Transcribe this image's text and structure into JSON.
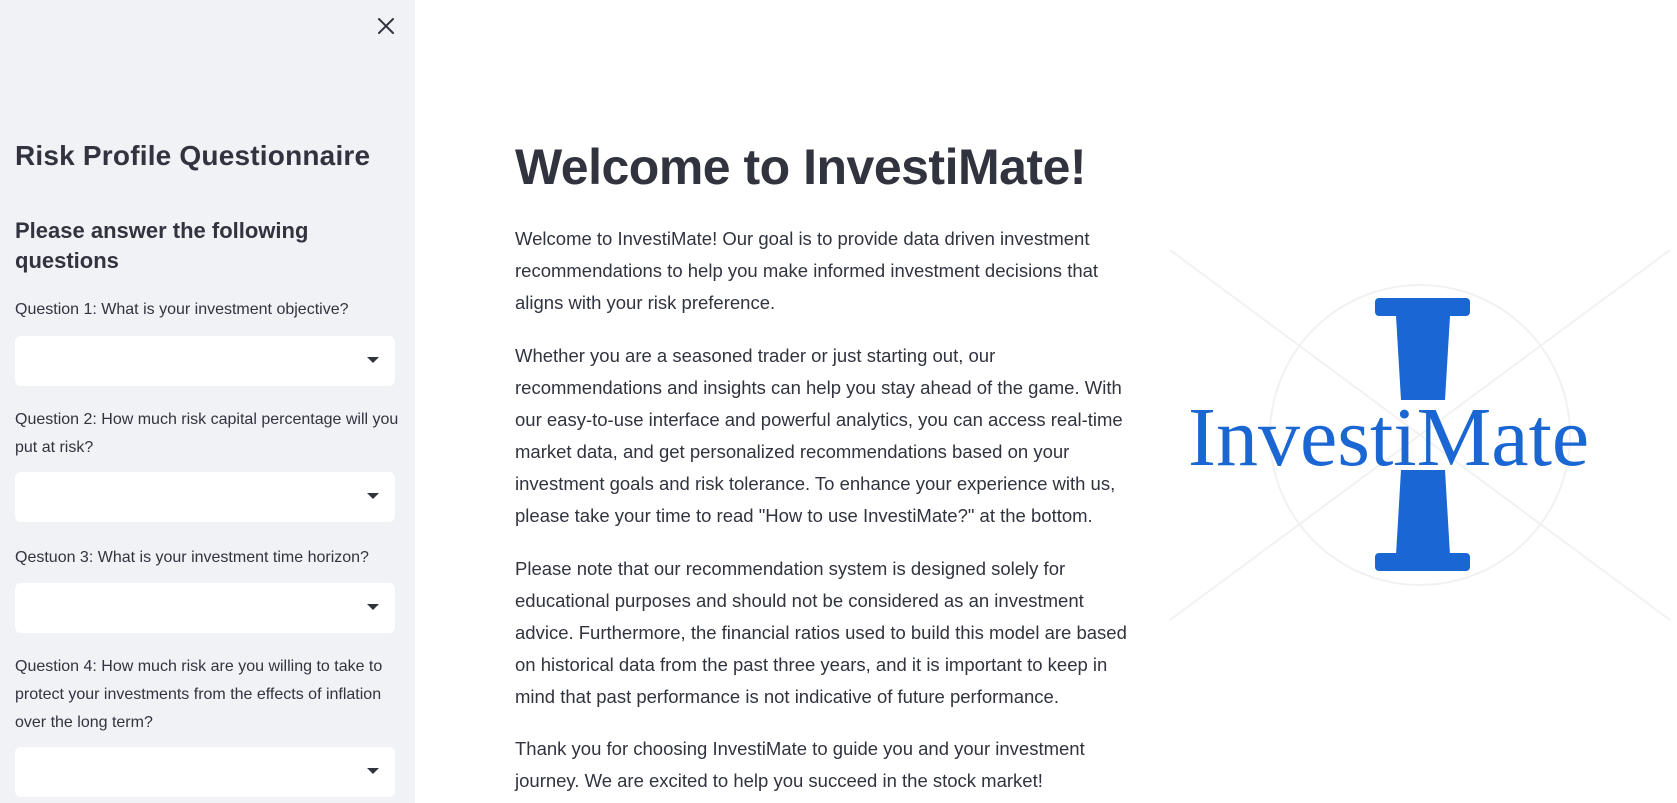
{
  "sidebar": {
    "title": "Risk Profile Questionnaire",
    "subtitle": "Please answer the following questions",
    "questions": [
      {
        "label": "Question 1: What is your investment objective?",
        "value": ""
      },
      {
        "label": "Question 2: How much risk capital percentage will you put at risk?",
        "value": ""
      },
      {
        "label": "Qestuon 3: What is your investment time horizon?",
        "value": ""
      },
      {
        "label": "Question 4: How much risk are you willing to take to protect your investments from the effects of inflation over the long term?",
        "value": ""
      }
    ]
  },
  "main": {
    "title": "Welcome to InvestiMate!",
    "paragraphs": [
      "Welcome to InvestiMate! Our goal is to provide data driven investment recommendations to help you make informed investment decisions that aligns with your risk preference.",
      "Whether you are a seasoned trader or just starting out, our recommendations and insights can help you stay ahead of the game. With our easy-to-use interface and powerful analytics, you can access real-time market data, and get personalized recommendations based on your investment goals and risk tolerance. To enhance your experience with us, please take your time to read \"How to use InvestiMate?\" at the bottom.",
      "Please note that our recommendation system is designed solely for educational purposes and should not be considered as an investment advice. Furthermore, the financial ratios used to build this model are based on historical data from the past three years, and it is important to keep in mind that past performance is not indicative of future performance.",
      "Thank you for choosing InvestiMate to guide you and your investment journey. We are excited to help you succeed in the stock market!"
    ],
    "logo": {
      "text": "InvestiMate",
      "color": "#1a66d2"
    }
  },
  "colors": {
    "sidebar_bg": "#f0f2f6",
    "text": "#31333f",
    "brand": "#1a66d2"
  },
  "icons": {
    "close": "close-icon",
    "caret": "caret-down-icon"
  }
}
